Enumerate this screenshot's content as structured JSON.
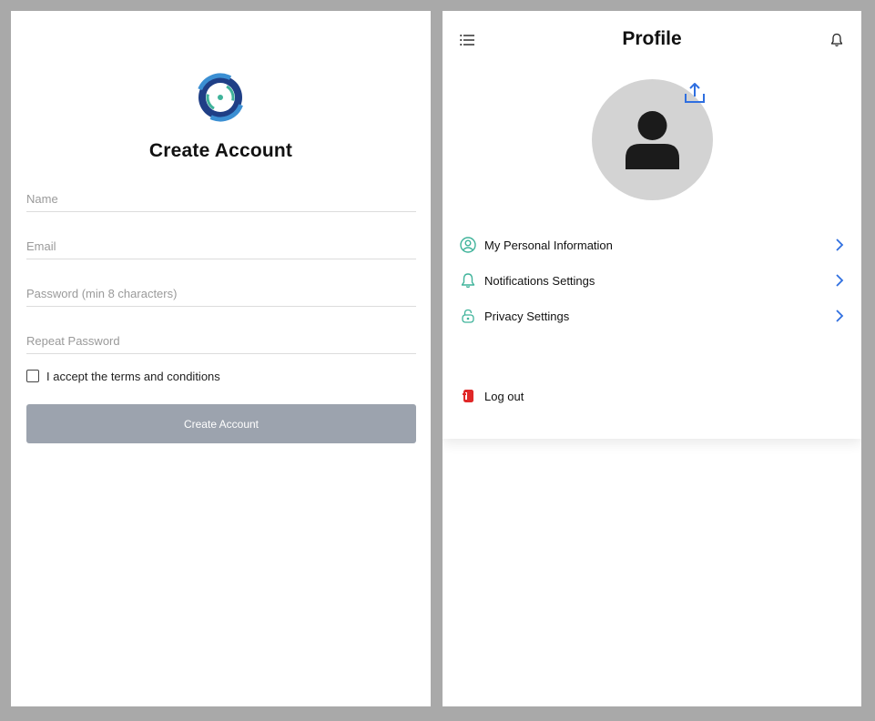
{
  "signup": {
    "title": "Create Account",
    "name_placeholder": "Name",
    "email_placeholder": "Email",
    "password_placeholder": "Password (min 8 characters)",
    "repeat_password_placeholder": "Repeat Password",
    "terms_label": "I accept the terms and conditions",
    "terms_checked": false,
    "submit_label": "Create Account",
    "logo_icon": "circle-logo-icon"
  },
  "profile": {
    "title": "Profile",
    "menu_icon": "hamburger-menu-icon",
    "bell_icon": "bell-icon",
    "avatar_icon": "user-silhouette-icon",
    "upload_icon": "upload-icon",
    "items": [
      {
        "label": "My Personal Information",
        "icon": "user-circle-icon"
      },
      {
        "label": "Notifications Settings",
        "icon": "bell-icon"
      },
      {
        "label": "Privacy Settings",
        "icon": "lock-icon"
      }
    ],
    "logout_label": "Log out",
    "logout_icon": "logout-door-icon"
  },
  "colors": {
    "accent_teal": "#3fb39a",
    "chevron_blue": "#2f6fe0",
    "button_disabled": "#9ca3ae",
    "logout_red": "#e02828"
  }
}
